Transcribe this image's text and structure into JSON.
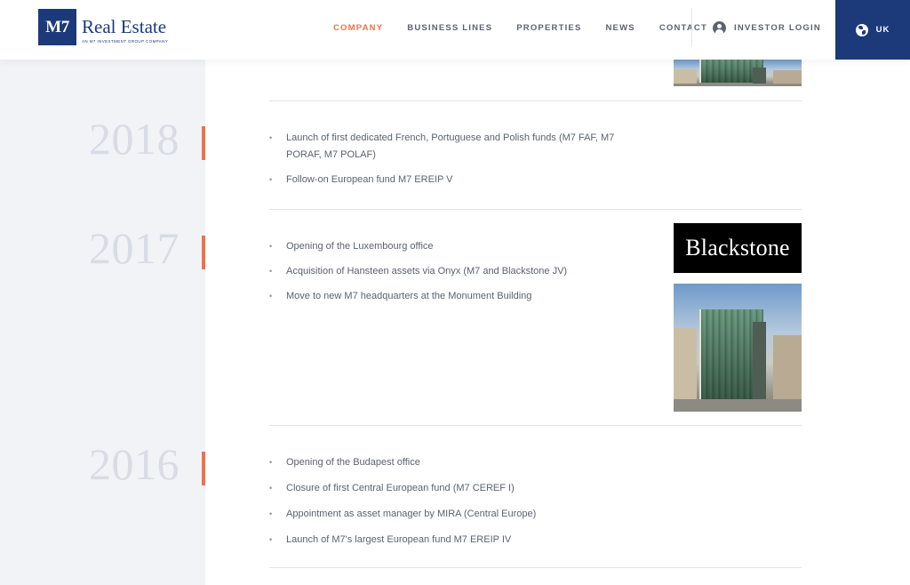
{
  "header": {
    "logo_mark": "M7",
    "logo_name": "Real Estate",
    "logo_tagline": "AN M7 INVESTMENT GROUP COMPANY",
    "nav": [
      {
        "label": "COMPANY",
        "active": true
      },
      {
        "label": "BUSINESS LINES",
        "active": false
      },
      {
        "label": "PROPERTIES",
        "active": false
      },
      {
        "label": "NEWS",
        "active": false
      },
      {
        "label": "CONTACT",
        "active": false
      }
    ],
    "login_label": "INVESTOR LOGIN",
    "country_label": "UK"
  },
  "timeline": [
    {
      "year": "2018",
      "items": [
        "Launch of first dedicated French, Portuguese and Polish funds (M7 FAF, M7 PORAF, M7 POLAF)",
        "Follow-on European fund M7 EREIP V"
      ]
    },
    {
      "year": "2017",
      "items": [
        "Opening of the Luxembourg office",
        "Acquisition of Hansteen assets via Onyx (M7 and Blackstone JV)",
        "Move to new M7 headquarters at the Monument Building"
      ],
      "logo_text": "Blackstone"
    },
    {
      "year": "2016",
      "items": [
        "Opening of the Budapest office",
        "Closure of first Central European fund (M7 CEREF I)",
        "Appointment as asset manager by MIRA (Central Europe)",
        "Launch of M7's largest European fund M7 EREIP IV"
      ]
    }
  ],
  "colors": {
    "brand_navy": "#1c3a7a",
    "accent_orange": "#f0714b",
    "year_grey": "#d8dce6",
    "left_column_bg": "#f2f3f6"
  }
}
